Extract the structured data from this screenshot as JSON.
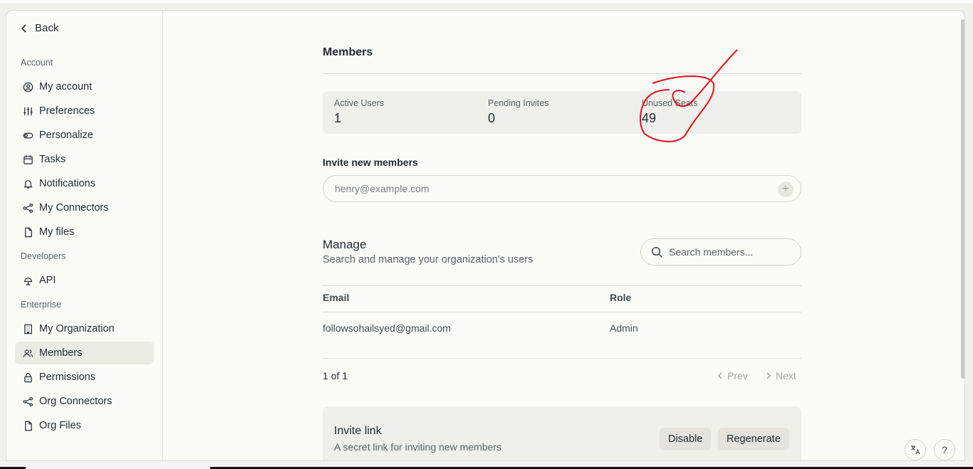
{
  "colors": {
    "accent_active_bg": "#ebebe6",
    "annotation": "#e8101a"
  },
  "sidebar": {
    "back_label": "Back",
    "sections": [
      {
        "label": "Account"
      },
      {
        "label": "Developers"
      },
      {
        "label": "Enterprise"
      }
    ],
    "items": [
      {
        "label": "My account",
        "icon": "user-circle-icon"
      },
      {
        "label": "Preferences",
        "icon": "sliders-icon"
      },
      {
        "label": "Personalize",
        "icon": "toggle-icon"
      },
      {
        "label": "Tasks",
        "icon": "calendar-icon"
      },
      {
        "label": "Notifications",
        "icon": "bell-icon"
      },
      {
        "label": "My Connectors",
        "icon": "connectors-icon"
      },
      {
        "label": "My files",
        "icon": "file-icon"
      },
      {
        "label": "API",
        "icon": "api-icon"
      },
      {
        "label": "My Organization",
        "icon": "building-icon"
      },
      {
        "label": "Members",
        "icon": "users-icon",
        "active": true
      },
      {
        "label": "Permissions",
        "icon": "lock-icon"
      },
      {
        "label": "Org Connectors",
        "icon": "connectors-icon"
      },
      {
        "label": "Org Files",
        "icon": "file-icon"
      }
    ]
  },
  "main": {
    "title": "Members",
    "stats": [
      {
        "label": "Active Users",
        "value": "1"
      },
      {
        "label": "Pending Invites",
        "value": "0"
      },
      {
        "label": "Unused Seats",
        "value": "49"
      }
    ],
    "invite": {
      "label": "Invite new members",
      "placeholder": "henry@example.com"
    },
    "manage": {
      "title": "Manage",
      "subtitle": "Search and manage your organization's users",
      "search_placeholder": "Search members..."
    },
    "table": {
      "columns": [
        "Email",
        "Role"
      ],
      "rows": [
        {
          "email": "followsohailsyed@gmail.com",
          "role": "Admin"
        }
      ]
    },
    "pager": {
      "count": "1 of 1",
      "prev": "Prev",
      "next": "Next"
    },
    "invite_link": {
      "title": "Invite link",
      "subtitle": "A secret link for inviting new members",
      "disable_label": "Disable",
      "regenerate_label": "Regenerate"
    },
    "help_label": "?"
  }
}
